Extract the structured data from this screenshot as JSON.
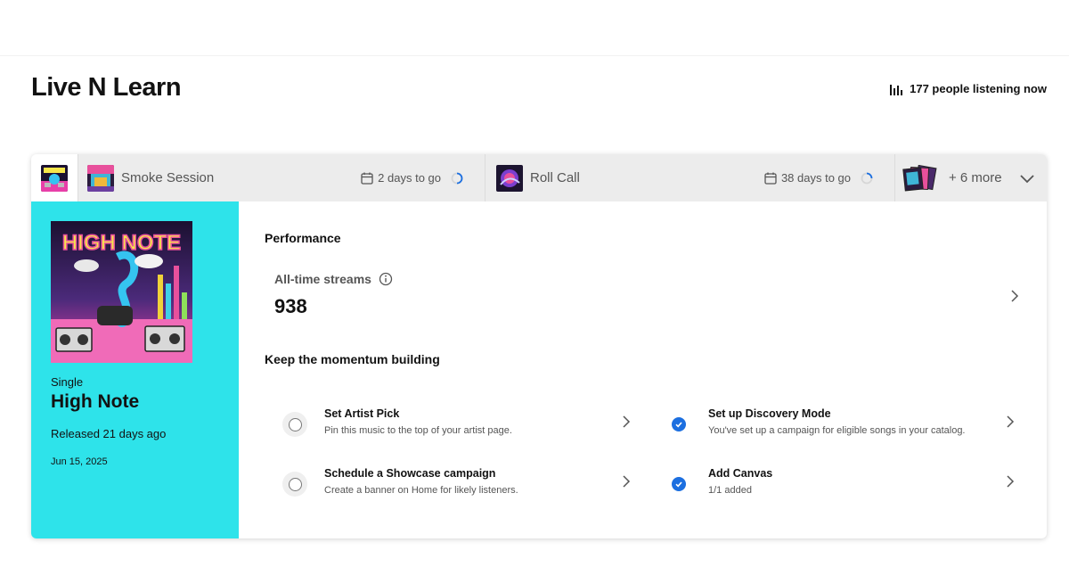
{
  "artist": {
    "name": "Live N Learn"
  },
  "listeners": {
    "icon": "bars-chart-icon",
    "text": "177 people listening now"
  },
  "tabs": [
    {
      "title": "Smoke Session",
      "countdown": "2 days to go",
      "progress": 0.25
    },
    {
      "title": "Roll Call",
      "countdown": "38 days to go",
      "progress": 0.3
    },
    {
      "more_label": "+ 6 more"
    }
  ],
  "release": {
    "type": "Single",
    "title": "High Note",
    "released": "Released 21 days ago",
    "date": "Jun 15, 2025",
    "cover_text": "HIGH NOTE",
    "accent_color": "#2ee3ea"
  },
  "performance": {
    "heading": "Performance",
    "streams_label": "All-time streams",
    "streams_value": "938"
  },
  "momentum": {
    "heading": "Keep the momentum building",
    "tasks": [
      {
        "title": "Set Artist Pick",
        "desc": "Pin this music to the top of your artist page.",
        "done": false
      },
      {
        "title": "Schedule a Showcase campaign",
        "desc": "Create a banner on Home for likely listeners.",
        "done": false
      },
      {
        "title": "Set up Discovery Mode",
        "desc": "You've set up a campaign for eligible songs in your catalog.",
        "done": true
      },
      {
        "title": "Add Canvas",
        "desc": "1/1 added",
        "done": true
      }
    ]
  },
  "colors": {
    "check_blue": "#1c6fe0",
    "tab_bg": "#ececec"
  }
}
